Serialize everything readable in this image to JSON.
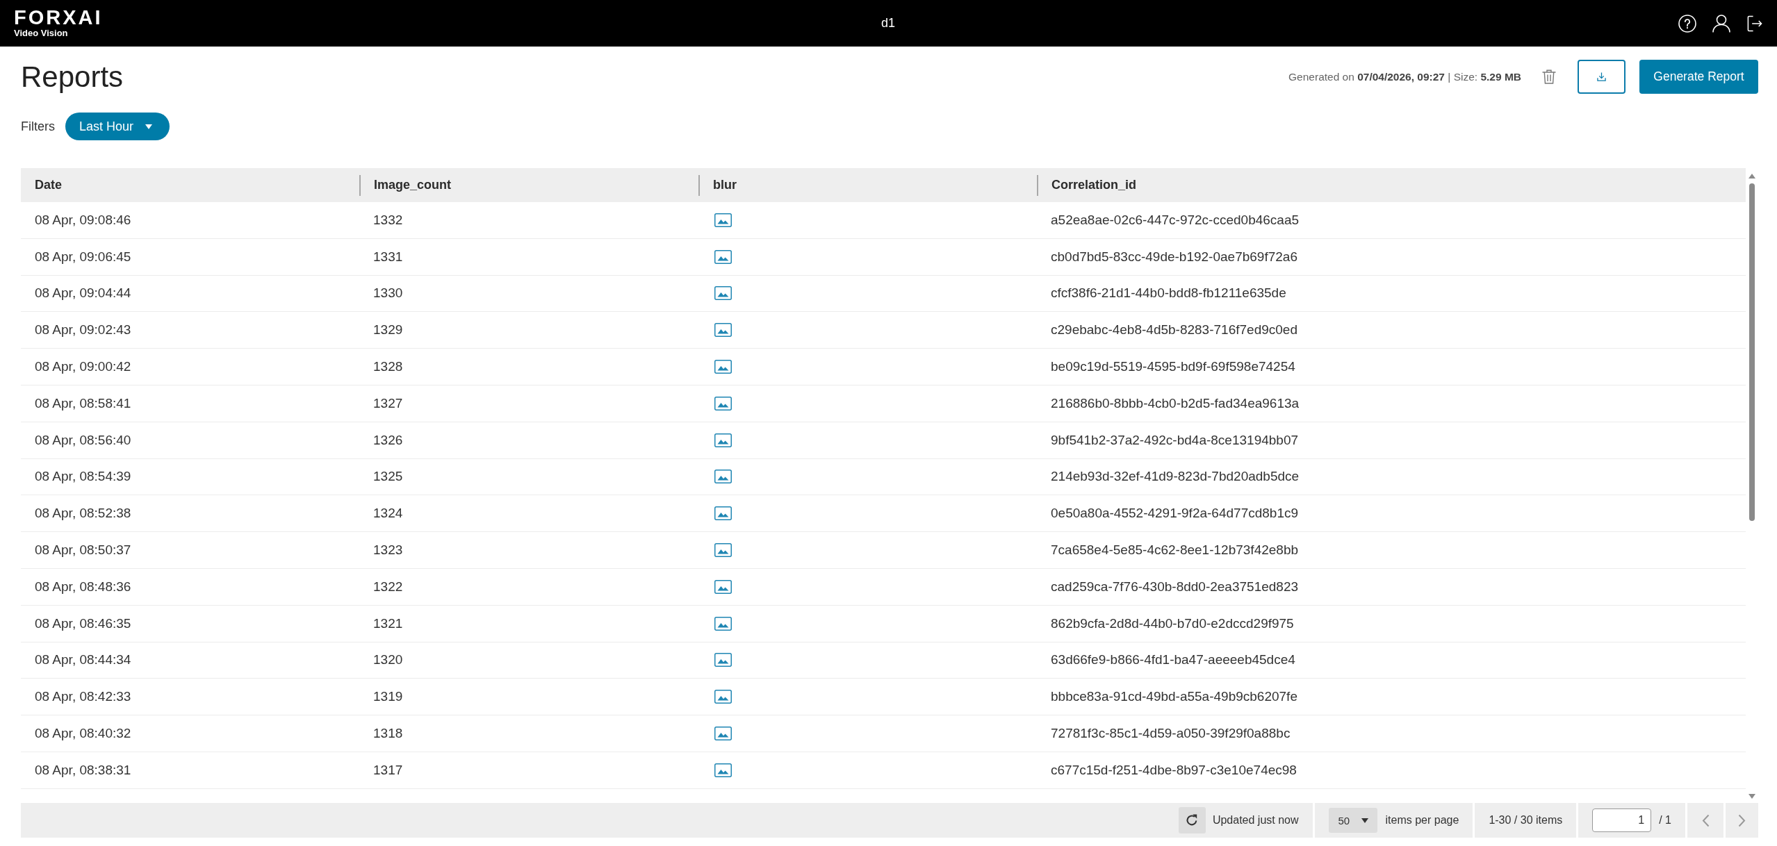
{
  "app_bar": {
    "logo": {
      "wordmark": "FORXAI",
      "subtitle": "Video Vision"
    },
    "title": "d1"
  },
  "header": {
    "title": "Reports",
    "report_info": "Generated on **07/04/2026, 09:27** | Size: **5.29 MB**",
    "generate_button": "Generate Report"
  },
  "filters": {
    "label": "Filters",
    "selected_filter": "Last Hour"
  },
  "table": {
    "columns": [
      "Date",
      "Image_count",
      "blur",
      "Correlation_id"
    ],
    "rows": [
      {
        "date": "08 Apr, 09:08:46",
        "image_count": "1332",
        "correlation_id": "a52ea8ae-02c6-447c-972c-cced0b46caa5"
      },
      {
        "date": "08 Apr, 09:06:45",
        "image_count": "1331",
        "correlation_id": "cb0d7bd5-83cc-49de-b192-0ae7b69f72a6"
      },
      {
        "date": "08 Apr, 09:04:44",
        "image_count": "1330",
        "correlation_id": "cfcf38f6-21d1-44b0-bdd8-fb1211e635de"
      },
      {
        "date": "08 Apr, 09:02:43",
        "image_count": "1329",
        "correlation_id": "c29ebabc-4eb8-4d5b-8283-716f7ed9c0ed"
      },
      {
        "date": "08 Apr, 09:00:42",
        "image_count": "1328",
        "correlation_id": "be09c19d-5519-4595-bd9f-69f598e74254"
      },
      {
        "date": "08 Apr, 08:58:41",
        "image_count": "1327",
        "correlation_id": "216886b0-8bbb-4cb0-b2d5-fad34ea9613a"
      },
      {
        "date": "08 Apr, 08:56:40",
        "image_count": "1326",
        "correlation_id": "9bf541b2-37a2-492c-bd4a-8ce13194bb07"
      },
      {
        "date": "08 Apr, 08:54:39",
        "image_count": "1325",
        "correlation_id": "214eb93d-32ef-41d9-823d-7bd20adb5dce"
      },
      {
        "date": "08 Apr, 08:52:38",
        "image_count": "1324",
        "correlation_id": "0e50a80a-4552-4291-9f2a-64d77cd8b1c9"
      },
      {
        "date": "08 Apr, 08:50:37",
        "image_count": "1323",
        "correlation_id": "7ca658e4-5e85-4c62-8ee1-12b73f42e8bb"
      },
      {
        "date": "08 Apr, 08:48:36",
        "image_count": "1322",
        "correlation_id": "cad259ca-7f76-430b-8dd0-2ea3751ed823"
      },
      {
        "date": "08 Apr, 08:46:35",
        "image_count": "1321",
        "correlation_id": "862b9cfa-2d8d-44b0-b7d0-e2dccd29f975"
      },
      {
        "date": "08 Apr, 08:44:34",
        "image_count": "1320",
        "correlation_id": "63d66fe9-b866-4fd1-ba47-aeeeeb45dce4"
      },
      {
        "date": "08 Apr, 08:42:33",
        "image_count": "1319",
        "correlation_id": "bbbce83a-91cd-49bd-a55a-49b9cb6207fe"
      },
      {
        "date": "08 Apr, 08:40:32",
        "image_count": "1318",
        "correlation_id": "72781f3c-85c1-4d59-a050-39f29f0a88bc"
      },
      {
        "date": "08 Apr, 08:38:31",
        "image_count": "1317",
        "correlation_id": "c677c15d-f251-4dbe-8b97-c3e10e74ec98"
      }
    ]
  },
  "pagination": {
    "status": "Updated just now",
    "page_size": "50",
    "page_size_label": "items per page",
    "range": "1-30 / 30 items",
    "page": "1",
    "page_total": "/ 1"
  }
}
